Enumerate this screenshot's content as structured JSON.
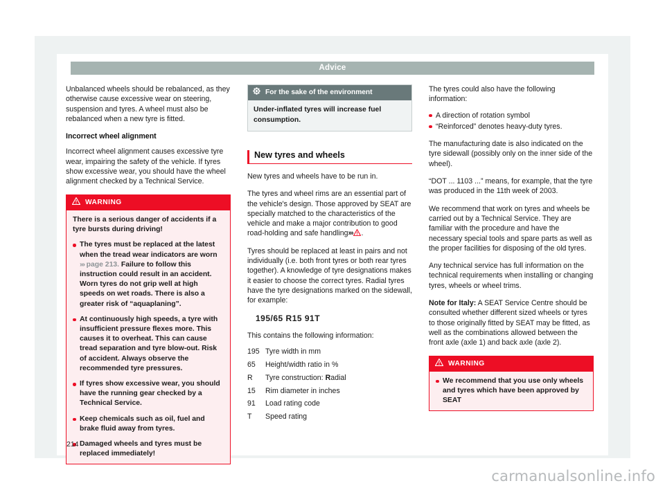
{
  "header": {
    "title": "Advice"
  },
  "page_number": "214",
  "watermark": "carmanualsonline.info",
  "colors": {
    "header_bar": "#a6b4b1",
    "warning_red": "#ed0e25",
    "warning_bg": "#fdeef0",
    "env_head": "#69797a",
    "env_bg": "#f0f3f3",
    "xref_gray": "#8d9396",
    "page_bg": "#eef2f2"
  },
  "column_left": {
    "intro_paragraph": "Unbalanced wheels should be rebalanced, as they otherwise cause excessive wear on steering, suspension and tyres. A wheel must also be rebalanced when a new tyre is fitted.",
    "subheading": "Incorrect wheel alignment",
    "alignment_paragraph": "Incorrect wheel alignment causes excessive tyre wear, impairing the safety of the vehicle. If tyres show excessive wear, you should have the wheel alignment checked by a Technical Service.",
    "warning": {
      "icon": "warning-triangle-icon",
      "label": "WARNING",
      "lead": "There is a serious danger of accidents if a tyre bursts during driving!",
      "bullets": [
        {
          "text_before": "The tyres must be replaced at the latest when the tread wear indicators are worn ",
          "xref_chevron": "›››",
          "xref": " page 213.",
          "text_after": " Failure to follow this instruction could result in an accident. Worn tyres do not grip well at high speeds on wet roads. There is also a greater risk of “aquaplaning”."
        },
        {
          "text_before": "At continuously high speeds, a tyre with insufficient pressure flexes more. This causes it to overheat. This can cause tread separation and tyre blow-out. Risk of accident. Always observe the recommended tyre pressures.",
          "xref_chevron": "",
          "xref": "",
          "text_after": ""
        },
        {
          "text_before": "If tyres show excessive wear, you should have the running gear checked by a Technical Service.",
          "xref_chevron": "",
          "xref": "",
          "text_after": ""
        },
        {
          "text_before": "Keep chemicals such as oil, fuel and brake fluid away from tyres.",
          "xref_chevron": "",
          "xref": "",
          "text_after": ""
        },
        {
          "text_before": "Damaged wheels and tyres must be replaced immediately!",
          "xref_chevron": "",
          "xref": "",
          "text_after": ""
        }
      ]
    }
  },
  "column_middle": {
    "environment_box": {
      "icon": "environment-flower-icon",
      "label": "For the sake of the environment",
      "body": "Under-inflated tyres will increase fuel consumption."
    },
    "section_heading": "New tyres and wheels",
    "para_1": "New tyres and wheels have to be run in.",
    "para_2_before": "The tyres and wheel rims are an essential part of the vehicle's design. Those approved by SEAT are specially matched to the characteristics of the vehicle and make a major contribution to good road-holding and safe handling",
    "para_2_chevron": "›››",
    "para_2_after": ".",
    "para_3": "Tyres should be replaced at least in pairs and not individually (i.e. both front tyres or both rear tyres together). A knowledge of tyre designations makes it easier to choose the correct tyres. Radial tyres have the tyre designations marked on the sidewall, for example:",
    "tyre_code": "195/65  R15  91T",
    "list_intro": "This contains the following information:",
    "definitions": [
      {
        "key": "195",
        "value": "Tyre width in mm"
      },
      {
        "key": "65",
        "value": "Height/width ratio in %"
      },
      {
        "key": "R",
        "value_bold": "R",
        "value": "Tyre construction: Radial"
      },
      {
        "key": "15",
        "value": "Rim diameter in inches"
      },
      {
        "key": "91",
        "value": "Load rating code"
      },
      {
        "key": "T",
        "value": "Speed rating"
      }
    ]
  },
  "column_right": {
    "para_1": "The tyres could also have the following information:",
    "bullets": [
      "A direction of rotation symbol",
      "“Reinforced” denotes heavy-duty tyres."
    ],
    "para_2": "The manufacturing date is also indicated on the tyre sidewall (possibly only on the inner side of the wheel).",
    "para_3": "“DOT ... 1103 ...” means, for example, that the tyre was produced in the 11th week of 2003.",
    "para_4": "We recommend that work on tyres and wheels be carried out by a Technical Service. They are familiar with the procedure and have the necessary special tools and spare parts as well as the proper facilities for disposing of the old tyres.",
    "para_5": "Any technical service has full information on the technical requirements when installing or changing tyres, wheels or wheel trims.",
    "note_label": "Note for Italy:",
    "note_text": " A SEAT Service Centre should be consulted whether different sized wheels or tyres to those originally fitted by SEAT may be fitted, as well as the combinations allowed between the front axle (axle 1) and back axle (axle 2).",
    "warning": {
      "icon": "warning-triangle-icon",
      "label": "WARNING",
      "bullets": [
        "We recommend that you use only wheels and tyres which have been approved by SEAT"
      ]
    }
  }
}
